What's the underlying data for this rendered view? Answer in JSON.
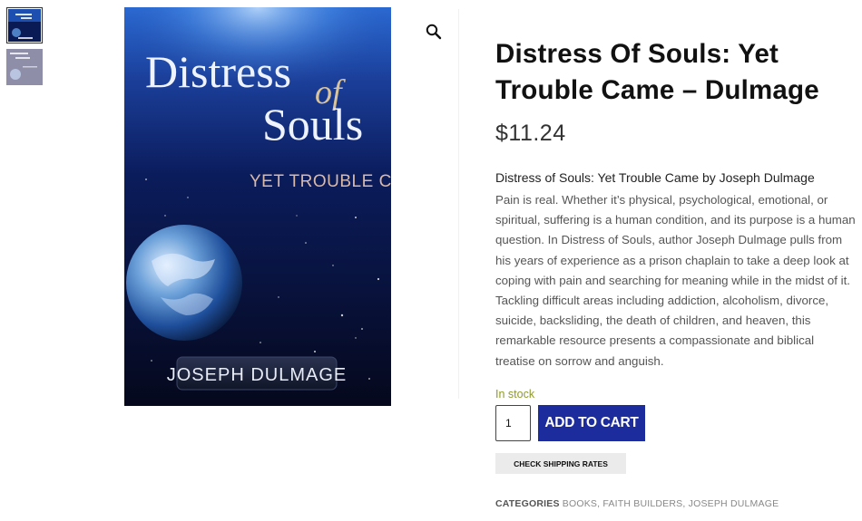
{
  "product": {
    "title": "Distress Of Souls: Yet Trouble Came – Dulmage",
    "price": "$11.24",
    "description_lead": "Distress of Souls: Yet Trouble Came by Joseph Dulmage",
    "description": "Pain is real. Whether it’s physical, psychological, emotional, or spiritual, suffering is a human condition, and its purpose is a human question. In Distress of Souls, author Joseph Dulmage pulls from his years of experience as a prison chaplain to take a deep look at coping with pain and searching for meaning while in the midst of it. Tackling difficult areas including addiction, alcoholism, divorce, suicide, backsliding, the death of children, and heaven, this remarkable resource presents a compassionate and biblical treatise on sorrow and anguish.",
    "stock": "In stock",
    "quantity": "1",
    "add_to_cart": "ADD TO CART",
    "check_shipping": "CHECK SHIPPING RATES",
    "categories_label": "CATEGORIES",
    "categories": [
      "BOOKS",
      "FAITH BUILDERS",
      "JOSEPH DULMAGE"
    ]
  },
  "cover": {
    "title_line1": "Distress",
    "title_of": "of",
    "title_line2": "Souls",
    "subtitle": "YET TROUBLE CAME",
    "author": "JOSEPH DULMAGE"
  },
  "icons": {
    "zoom": "magnifier-icon"
  },
  "colors": {
    "accent": "#1d2c9c",
    "stock": "#8f9a2b",
    "cover_bg": "#07102a"
  }
}
